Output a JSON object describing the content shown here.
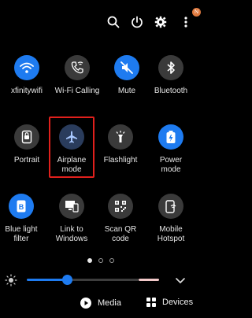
{
  "topbar": {
    "icons": [
      "search-icon",
      "power-icon",
      "settings-icon",
      "more-icon"
    ],
    "notification_badge": "N"
  },
  "tiles": [
    {
      "label": "xfinitywifi",
      "icon": "wifi-icon",
      "active": true
    },
    {
      "label": "Wi-Fi Calling",
      "icon": "wifi-calling-icon",
      "active": false
    },
    {
      "label": "Mute",
      "icon": "mute-icon",
      "active": true
    },
    {
      "label": "Bluetooth",
      "icon": "bluetooth-icon",
      "active": false
    },
    {
      "label": "Portrait",
      "icon": "portrait-icon",
      "active": false
    },
    {
      "label": "Airplane\nmode",
      "icon": "airplane-icon",
      "active": false
    },
    {
      "label": "Flashlight",
      "icon": "flashlight-icon",
      "active": false
    },
    {
      "label": "Power\nmode",
      "icon": "power-mode-icon",
      "active": true
    },
    {
      "label": "Blue light\nfilter",
      "icon": "blue-light-icon",
      "active": true
    },
    {
      "label": "Link to\nWindows",
      "icon": "link-windows-icon",
      "active": false
    },
    {
      "label": "Scan QR\ncode",
      "icon": "qr-icon",
      "active": false
    },
    {
      "label": "Mobile\nHotspot",
      "icon": "hotspot-icon",
      "active": false
    }
  ],
  "pager": {
    "pages": 3,
    "active_index": 0
  },
  "brightness": {
    "level": 0.29
  },
  "bottom": {
    "media_label": "Media",
    "devices_label": "Devices"
  },
  "colors": {
    "accent": "#1e7bf0",
    "highlight": "#e0201c",
    "tile_off": "#3a3a3a"
  }
}
